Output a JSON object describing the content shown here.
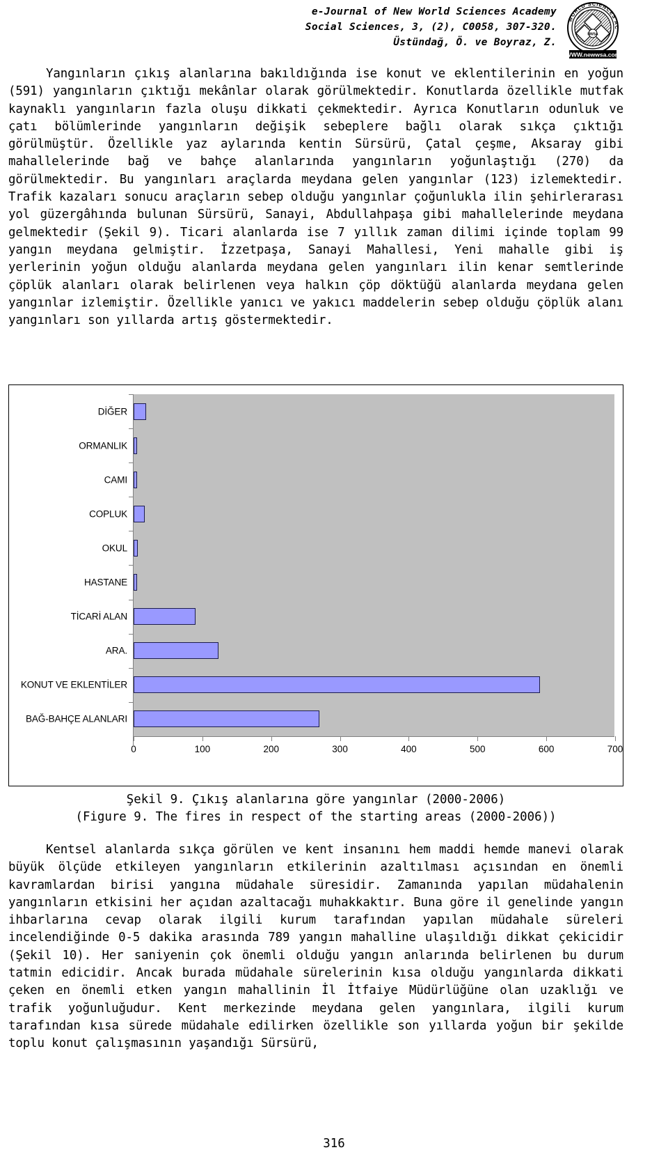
{
  "header": {
    "line1": "e-Journal of New World Sciences Academy",
    "line2": "Social Sciences, 3, (2), C0058, 307-320.",
    "line3": "Üstündağ, Ö. ve Boyraz, Z.",
    "logo_top_text": "WORLD SCIENCES ACADEMY",
    "logo_bottom_text": "NEW",
    "logo_center_text": "NWSA",
    "logo_url_text": "WWW.newwsa.com"
  },
  "paragraph_top": "Yangınların çıkış alanlarına bakıldığında ise konut ve eklentilerinin en yoğun (591) yangınların çıktığı mekânlar olarak görülmektedir. Konutlarda özellikle mutfak kaynaklı yangınların fazla oluşu dikkati çekmektedir. Ayrıca Konutların odunluk ve çatı bölümlerinde yangınların değişik sebeplere bağlı olarak sıkça çıktığı görülmüştür. Özellikle yaz aylarında kentin Sürsürü, Çatal çeşme, Aksaray gibi mahallelerinde bağ ve bahçe alanlarında yangınların yoğunlaştığı (270) da görülmektedir. Bu yangınları araçlarda meydana gelen yangınlar (123) izlemektedir. Trafik kazaları sonucu araçların sebep olduğu yangınlar çoğunlukla ilin şehirlerarası yol güzergâhında bulunan Sürsürü, Sanayi, Abdullahpaşa gibi mahallelerinde meydana gelmektedir (Şekil 9). Ticari alanlarda ise 7 yıllık zaman dilimi içinde toplam 99 yangın meydana gelmiştir. İzzetpaşa, Sanayi Mahallesi, Yeni mahalle gibi iş yerlerinin yoğun olduğu alanlarda meydana gelen yangınları ilin kenar semtlerinde çöplük alanları olarak belirlenen veya halkın çöp döktüğü alanlarda meydana gelen yangınlar izlemiştir. Özellikle yanıcı ve yakıcı maddelerin sebep olduğu çöplük alanı yangınları son yıllarda artış göstermektedir.",
  "paragraph_bottom": "Kentsel alanlarda sıkça görülen ve kent insanını hem maddi hemde manevi olarak büyük ölçüde etkileyen yangınların etkilerinin azaltılması açısından en önemli kavramlardan birisi yangına müdahale süresidir. Zamanında yapılan müdahalenin yangınların etkisini her açıdan azaltacağı muhakkaktır. Buna göre il genelinde yangın ihbarlarına cevap olarak ilgili kurum tarafından yapılan müdahale süreleri incelendiğinde 0-5 dakika arasında 789 yangın mahalline ulaşıldığı dikkat çekicidir (Şekil 10). Her saniyenin çok önemli olduğu yangın anlarında belirlenen bu durum tatmin edicidir. Ancak burada müdahale sürelerinin kısa olduğu yangınlarda dikkati çeken en önemli etken yangın mahallinin İl İtfaiye Müdürlüğüne olan uzaklığı ve trafik yoğunluğudur. Kent merkezinde meydana gelen yangınlara, ilgili kurum tarafından kısa sürede müdahale edilirken özellikle son yıllarda yoğun bir şekilde toplu konut çalışmasının yaşandığı Sürsürü,",
  "caption": {
    "line_tr": "Şekil 9. Çıkış alanlarına göre yangınlar (2000-2006)",
    "line_en": "(Figure 9. The fires in respect of the starting areas (2000-2006))"
  },
  "page_number": "316",
  "chart_data": {
    "type": "bar",
    "orientation": "horizontal",
    "title": "",
    "xlabel": "",
    "ylabel": "",
    "xlim": [
      0,
      700
    ],
    "xticks": [
      0,
      100,
      200,
      300,
      400,
      500,
      600,
      700
    ],
    "grid": false,
    "legend": false,
    "plot_background": "#C0C0C0",
    "bar_color": "#9999FF",
    "bar_border_color": "#1B1B4D",
    "categories": [
      "DİĞER",
      "ORMANLIK",
      "CAMI",
      "COPLUK",
      "OKUL",
      "HASTANE",
      "TİCARİ ALAN",
      "ARA.",
      "KONUT VE EKLENTİLER",
      "BAĞ-BAHÇE ALANLARI"
    ],
    "values": [
      18,
      5,
      4,
      16,
      6,
      5,
      90,
      123,
      591,
      270
    ]
  }
}
